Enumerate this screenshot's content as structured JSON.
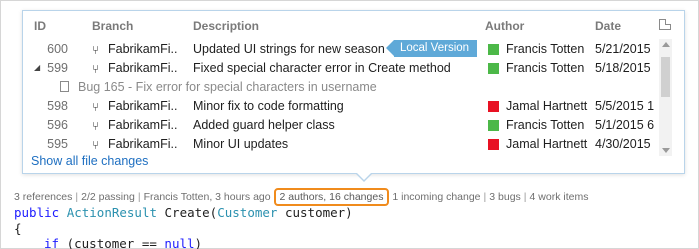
{
  "popup": {
    "columns": {
      "id": "ID",
      "branch": "Branch",
      "description": "Description",
      "author": "Author",
      "date": "Date"
    },
    "rows": [
      {
        "id": "600",
        "branch": "FabrikamFi...",
        "description": "Updated UI strings for new season",
        "author": "Francis Totten",
        "author_color": "#4cb848",
        "date": "5/21/2015",
        "tag": "Local Version"
      },
      {
        "id": "599",
        "branch": "FabrikamFi...",
        "description": "Fixed special character error in Create method",
        "author": "Francis Totten",
        "author_color": "#4cb848",
        "date": "5/18/2015",
        "expanded": true
      },
      {
        "bug": "Bug 165 - Fix error for special characters in username"
      },
      {
        "id": "598",
        "branch": "FabrikamFi...",
        "description": "Minor fix to code formatting",
        "author": "Jamal Hartnett",
        "author_color": "#e81123",
        "date": "5/5/2015 1"
      },
      {
        "id": "596",
        "branch": "FabrikamFi...",
        "description": "Added guard helper class",
        "author": "Francis Totten",
        "author_color": "#4cb848",
        "date": "5/1/2015 6"
      },
      {
        "id": "595",
        "branch": "FabrikamFi...",
        "description": "Minor UI updates",
        "author": "Jamal Hartnett",
        "author_color": "#e81123",
        "date": "4/30/2015"
      }
    ],
    "show_all_link": "Show all file changes"
  },
  "codelens": {
    "references": "3 references",
    "passing": "2/2 passing",
    "last_change": "Francis Totten, 3 hours ago",
    "authors_changes": "2 authors, 16 changes",
    "incoming": "1 incoming change",
    "bugs": "3 bugs",
    "work_items": "4 work items",
    "separator": "|"
  },
  "code": {
    "line1_kw": "public",
    "line1_type": "ActionResult",
    "line1_name": " Create(",
    "line1_param_type": "Customer",
    "line1_rest": " customer)",
    "line2": "{",
    "line3_kw": "if",
    "line3_mid": " (customer == ",
    "line3_null": "null",
    "line3_end": ")"
  },
  "colors": {
    "accent": "#5fa9d8",
    "link": "#1e6fc1",
    "highlight_border": "#f08b1c",
    "keyword": "#1d1cff",
    "type": "#2b91af"
  }
}
